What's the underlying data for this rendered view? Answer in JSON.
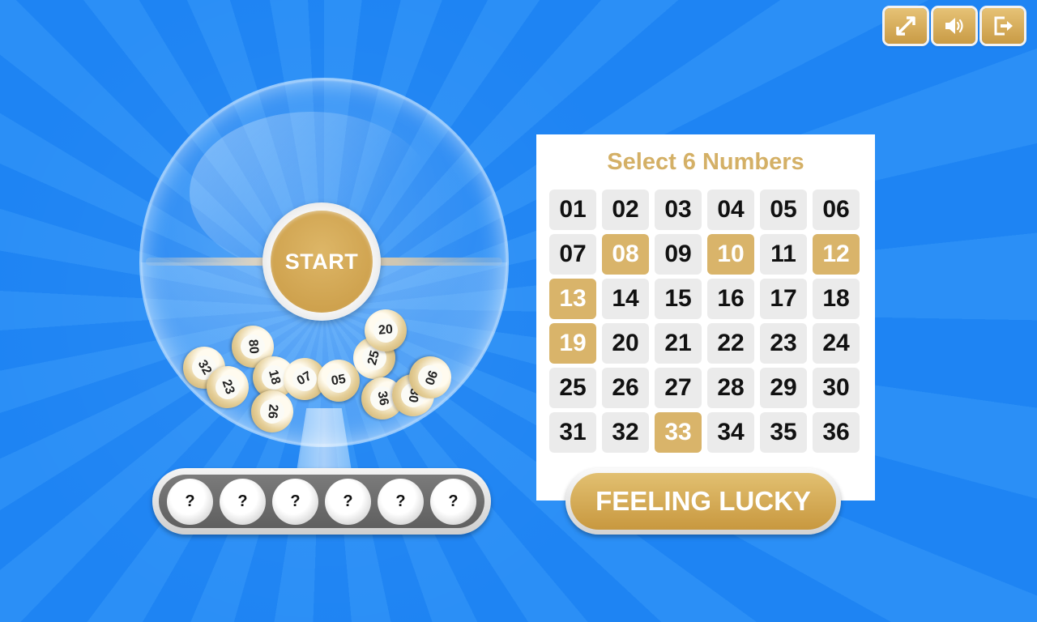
{
  "toolbar": {
    "fullscreen_icon": "fullscreen-icon",
    "sound_icon": "speaker-icon",
    "exit_icon": "exit-icon"
  },
  "machine": {
    "start_label": "START",
    "balls": [
      "32",
      "80",
      "23",
      "18",
      "07",
      "05",
      "25",
      "20",
      "36",
      "30",
      "90",
      "26"
    ],
    "result_slots": [
      "?",
      "?",
      "?",
      "?",
      "?",
      "?"
    ]
  },
  "panel": {
    "title": "Select 6 Numbers",
    "numbers": [
      "01",
      "02",
      "03",
      "04",
      "05",
      "06",
      "07",
      "08",
      "09",
      "10",
      "11",
      "12",
      "13",
      "14",
      "15",
      "16",
      "17",
      "18",
      "19",
      "20",
      "21",
      "22",
      "23",
      "24",
      "25",
      "26",
      "27",
      "28",
      "29",
      "30",
      "31",
      "32",
      "33",
      "34",
      "35",
      "36"
    ],
    "selected": [
      "08",
      "10",
      "12",
      "13",
      "19",
      "33"
    ]
  },
  "lucky_label": "FEELING LUCKY",
  "colors": {
    "accent_gold": "#d9b46a",
    "background_blue": "#2289f4",
    "cell_grey": "#ebebeb"
  }
}
